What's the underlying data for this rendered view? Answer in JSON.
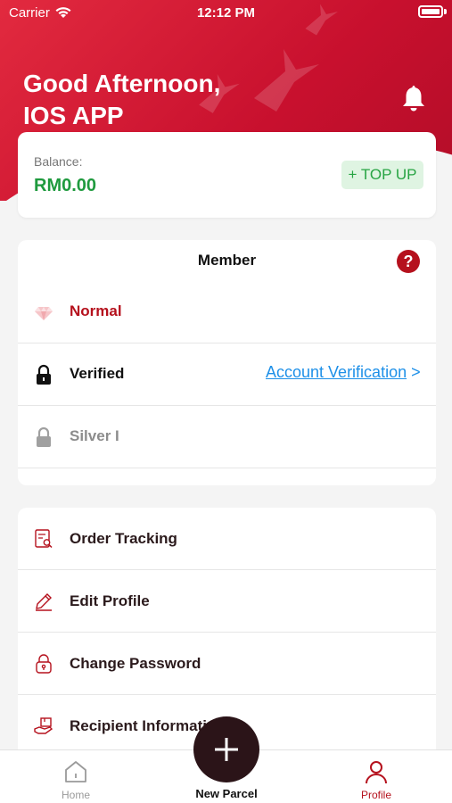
{
  "status_bar": {
    "carrier": "Carrier",
    "time": "12:12 PM"
  },
  "header": {
    "greeting_line1": "Good Afternoon,",
    "greeting_line2": "IOS APP",
    "bell_icon": "bell-icon"
  },
  "balance": {
    "label": "Balance:",
    "value": "RM0.00",
    "topup_label": "+ TOP UP"
  },
  "member": {
    "title": "Member",
    "help_symbol": "?",
    "rows": [
      {
        "label": "Normal",
        "icon": "diamond-icon",
        "color": "#b5111d"
      },
      {
        "label": "Verified",
        "icon": "lock-icon",
        "color": "#111111",
        "link": "Account Verification",
        "link_arrow": ">"
      },
      {
        "label": "Silver I",
        "icon": "lock-icon",
        "color": "#8c8c8c"
      }
    ]
  },
  "menu": {
    "items": [
      {
        "label": "Order Tracking",
        "icon": "order-tracking-icon"
      },
      {
        "label": "Edit Profile",
        "icon": "pencil-icon"
      },
      {
        "label": "Change Password",
        "icon": "padlock-icon"
      },
      {
        "label": "Recipient Informati",
        "icon": "recipient-icon"
      }
    ]
  },
  "tabbar": {
    "home": "Home",
    "new_parcel": "New Parcel",
    "profile": "Profile",
    "active_color": "#b5111d",
    "inactive_color": "#9a9a9a"
  },
  "colors": {
    "brand_red": "#c8102e",
    "green": "#1f9a3e",
    "link_blue": "#1e90e8"
  }
}
